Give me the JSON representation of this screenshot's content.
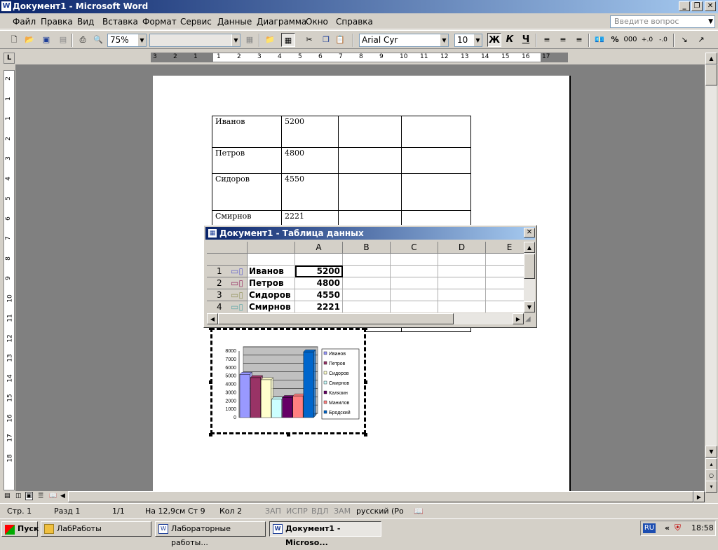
{
  "window": {
    "title": "Документ1 - Microsoft Word",
    "help_placeholder": "Введите вопрос"
  },
  "menu": [
    "Файл",
    "Правка",
    "Вид",
    "Вставка",
    "Формат",
    "Сервис",
    "Данные",
    "Диаграмма",
    "Окно",
    "Справка"
  ],
  "toolbar": {
    "zoom": "75%",
    "font": "Arial Cyr",
    "size": "10",
    "bold": "Ж",
    "italic": "К",
    "underline": "Ч",
    "percent": "%",
    "thousands": "000"
  },
  "ruler": {
    "h": [
      "3",
      "2",
      "1",
      "1",
      "2",
      "3",
      "4",
      "5",
      "6",
      "7",
      "8",
      "9",
      "10",
      "11",
      "12",
      "13",
      "14",
      "15",
      "16",
      "17"
    ],
    "v": [
      "2",
      "1",
      "1",
      "2",
      "3",
      "4",
      "5",
      "6",
      "7",
      "8",
      "9",
      "10",
      "11",
      "12",
      "13",
      "14",
      "15",
      "16",
      "17",
      "18"
    ]
  },
  "doc_table": [
    [
      "Иванов",
      "5200"
    ],
    [
      "Петров",
      "4800"
    ],
    [
      "Сидоров",
      "4550"
    ],
    [
      "Смирнов",
      "2221"
    ]
  ],
  "datasheet": {
    "title": "Документ1 - Таблица данных",
    "columns": [
      "A",
      "B",
      "C",
      "D",
      "E"
    ],
    "rows": [
      {
        "num": "1",
        "name": "Иванов",
        "value": "5200"
      },
      {
        "num": "2",
        "name": "Петров",
        "value": "4800"
      },
      {
        "num": "3",
        "name": "Сидоров",
        "value": "4550"
      },
      {
        "num": "4",
        "name": "Смирнов",
        "value": "2221"
      }
    ]
  },
  "chart_data": {
    "type": "bar",
    "categories": [
      "Иванов",
      "Петров",
      "Сидоров",
      "Смирнов",
      "Калязин",
      "Манилов",
      "Бродский"
    ],
    "values": [
      5200,
      4800,
      4550,
      2221,
      2400,
      2600,
      7900
    ],
    "colors": [
      "#9999FF",
      "#993366",
      "#FFFFCC",
      "#CCFFFF",
      "#660066",
      "#FF8080",
      "#0066CC"
    ],
    "yticks": [
      "8000",
      "7000",
      "6000",
      "5000",
      "4000",
      "3000",
      "2000",
      "1000",
      "0"
    ],
    "ylim": [
      0,
      8000
    ],
    "legend_position": "right"
  },
  "status": {
    "page": "Стр. 1",
    "section": "Разд 1",
    "pages": "1/1",
    "at": "На 12,9см",
    "line": "Ст 9",
    "col": "Кол 2",
    "rec": "ЗАП",
    "trk": "ИСПР",
    "ext": "ВДЛ",
    "ovr": "ЗАМ",
    "lang": "русский (Ро"
  },
  "taskbar": {
    "start": "Пуск",
    "tasks": [
      "ЛабРаботы",
      "Лабораторные работы...",
      "Документ1 - Microso..."
    ],
    "lang": "RU",
    "clock": "18:58"
  }
}
